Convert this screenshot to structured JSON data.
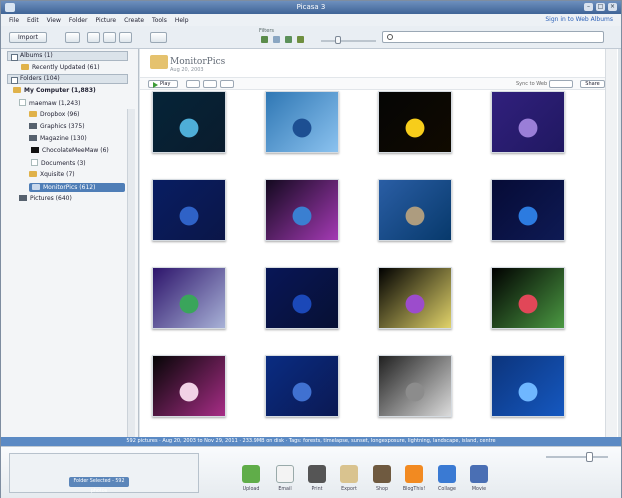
{
  "window": {
    "title": "Picasa 3"
  },
  "menu": [
    "File",
    "Edit",
    "View",
    "Folder",
    "Picture",
    "Create",
    "Tools",
    "Help"
  ],
  "toolbar": {
    "import_label": "Import",
    "filters_label": "Filters",
    "signin": "Sign in to Web Albums",
    "search": ""
  },
  "left_panel": {
    "albums": "Albums (1)",
    "recent": "Recently Updated (61)",
    "folders": "Folders (104)",
    "my_computer": "My Computer (1,883)",
    "items": [
      "maemaw (1,243)",
      "Dropbox (96)",
      "Graphics (375)",
      "Magazine (130)",
      "ChocolateMeeMaw (6)",
      "Documents (3)",
      "Xquisite (7)",
      "MonitorPics (612)",
      "Pictures (640)"
    ]
  },
  "album": {
    "title": "MonitorPics",
    "date": "Aug 20, 2003",
    "play": "Play",
    "sync": "Sync to Web",
    "share": "Share"
  },
  "status": "592 pictures · Aug 20, 2003 to Nov 29, 2011 · 233.9MB on disk · Tags: forests, timelapse, sunset, longexposure, lightning, landscape, island, centre",
  "tray": {
    "selection_label": "Folder Selected - 592 photos"
  },
  "actions": [
    "Upload",
    "Email",
    "Print",
    "Export",
    "Shop",
    "BlogThis!",
    "Collage",
    "Movie"
  ],
  "thumbnails": [
    {
      "name": "earth-horizon",
      "colors": [
        "#052438",
        "#4eaed8",
        "#0a1c2d"
      ]
    },
    {
      "name": "blue-swirls",
      "colors": [
        "#2f77b4",
        "#1d4f92",
        "#8bc2ef"
      ]
    },
    {
      "name": "yellow-lily",
      "colors": [
        "#050505",
        "#f7cd1b",
        "#100a00"
      ]
    },
    {
      "name": "violet-bokeh",
      "colors": [
        "#31207d",
        "#9a7ed8",
        "#201861"
      ]
    },
    {
      "name": "blue-bokeh",
      "colors": [
        "#081d62",
        "#2f62c7",
        "#0b1648"
      ]
    },
    {
      "name": "aurora-wave",
      "colors": [
        "#13091f",
        "#3a7fd1",
        "#a43ab4"
      ]
    },
    {
      "name": "sea-cliff",
      "colors": [
        "#2a5ea5",
        "#ad9c7f",
        "#07396b"
      ]
    },
    {
      "name": "blue-light-horizon",
      "colors": [
        "#060b36",
        "#2c7be0",
        "#0e1a54"
      ]
    },
    {
      "name": "christmas-tree",
      "colors": [
        "#2d146b",
        "#3aa55b",
        "#a8b2d7"
      ]
    },
    {
      "name": "blue-abstract",
      "colors": [
        "#081657",
        "#1b48b8",
        "#071033"
      ]
    },
    {
      "name": "purple-flower",
      "colors": [
        "#000000",
        "#9c4ccc",
        "#e1d36a"
      ]
    },
    {
      "name": "red-rose",
      "colors": [
        "#000000",
        "#e14758",
        "#4b9942"
      ]
    },
    {
      "name": "pink-lily",
      "colors": [
        "#050505",
        "#f1d2e6",
        "#a72d86"
      ]
    },
    {
      "name": "blue-sparkles",
      "colors": [
        "#0a2c82",
        "#4071d1",
        "#0b1953"
      ]
    },
    {
      "name": "gears-gray",
      "colors": [
        "#202020",
        "#8c8c8c",
        "#dcdcdc"
      ]
    },
    {
      "name": "blue-flames",
      "colors": [
        "#0c347c",
        "#6fb7ff",
        "#1558c0"
      ]
    }
  ]
}
